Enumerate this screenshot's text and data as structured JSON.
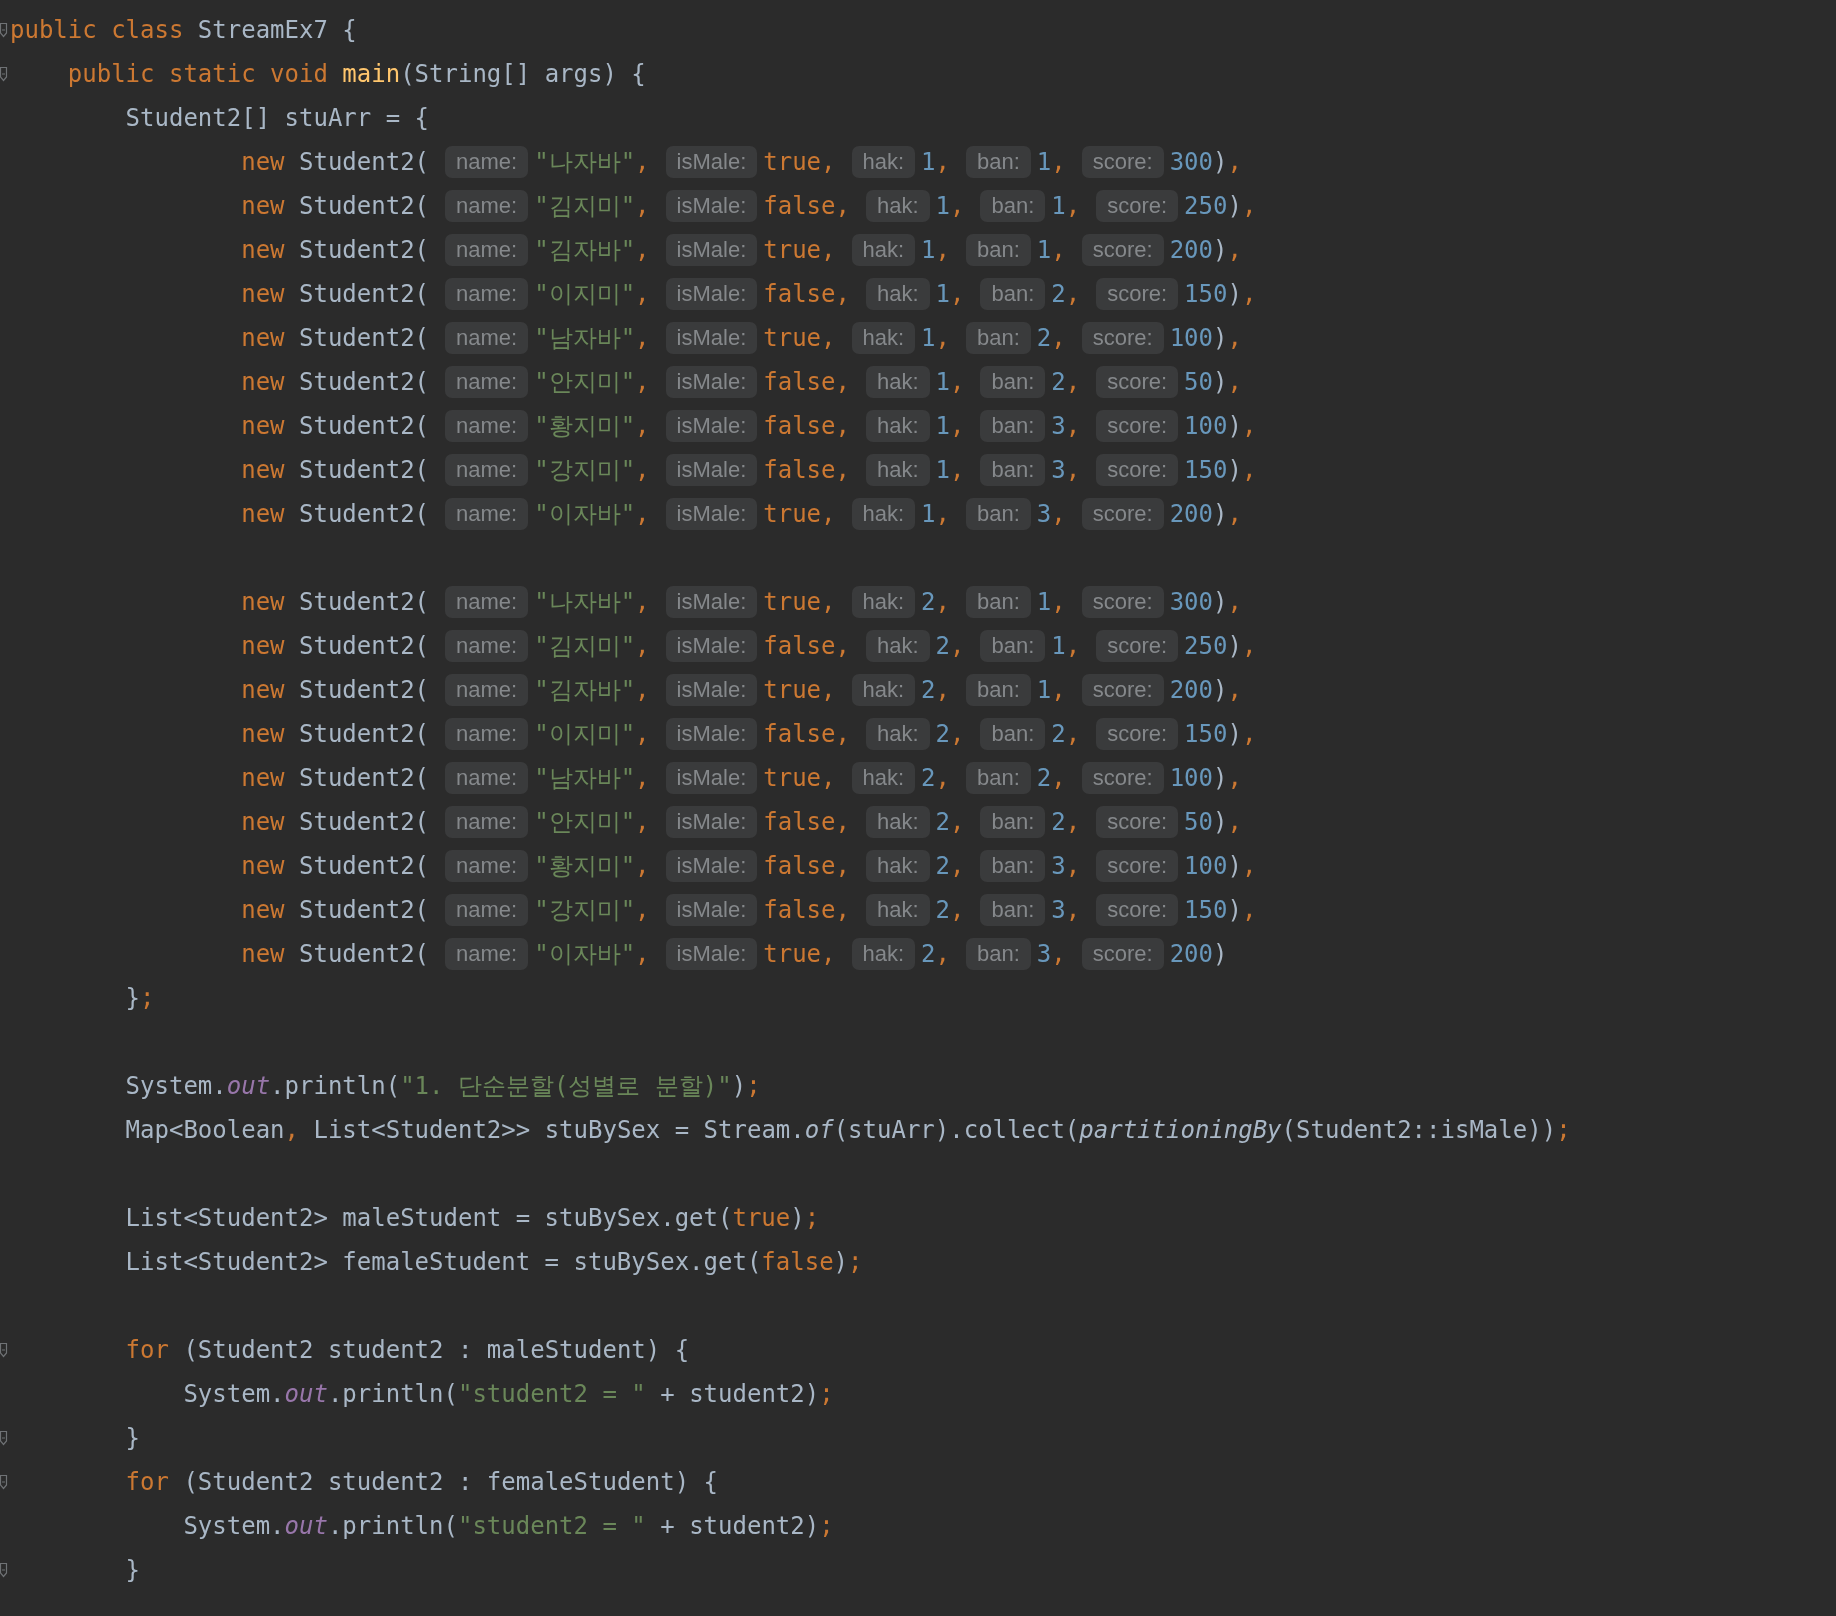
{
  "editor": {
    "lines": [
      {
        "kind": "code",
        "fold_mark": true,
        "tokens": [
          {
            "kind": "kw",
            "text": "public class"
          },
          {
            "kind": "plain",
            "text": " StreamEx7 {"
          }
        ],
        "children": [
          {
            "kind": "code",
            "fold_mark": true,
            "tokens": [
              {
                "kind": "kw",
                "text": "public static void "
              },
              {
                "kind": "fn",
                "text": "main"
              },
              {
                "kind": "plain",
                "text": "(String[] args) {"
              }
            ],
            "children": [
              {
                "kind": "code",
                "fold_mark": false,
                "tokens": [
                  {
                    "kind": "plain",
                    "text": "Student2[] stuArr = {"
                  }
                ],
                "children": [
                  {
                    "kind": "student",
                    "fold_mark": false,
                    "keyword": "new",
                    "call": " Student2(",
                    "args": [
                      {
                        "hint": "name:",
                        "value": "\"나자바\"",
                        "kind": "str",
                        "sep": ","
                      },
                      {
                        "hint": "isMale:",
                        "value": "true",
                        "kind": "kw",
                        "sep": ","
                      },
                      {
                        "hint": "hak:",
                        "value": "1",
                        "kind": "num",
                        "sep": ","
                      },
                      {
                        "hint": "ban:",
                        "value": "1",
                        "kind": "num",
                        "sep": ","
                      },
                      {
                        "hint": "score:",
                        "value": "300",
                        "kind": "num"
                      }
                    ],
                    "close": ")",
                    "end": ","
                  },
                  {
                    "kind": "student",
                    "fold_mark": false,
                    "keyword": "new",
                    "call": " Student2(",
                    "args": [
                      {
                        "hint": "name:",
                        "value": "\"김지미\"",
                        "kind": "str",
                        "sep": ","
                      },
                      {
                        "hint": "isMale:",
                        "value": "false",
                        "kind": "kw",
                        "sep": ","
                      },
                      {
                        "hint": "hak:",
                        "value": "1",
                        "kind": "num",
                        "sep": ","
                      },
                      {
                        "hint": "ban:",
                        "value": "1",
                        "kind": "num",
                        "sep": ","
                      },
                      {
                        "hint": "score:",
                        "value": "250",
                        "kind": "num"
                      }
                    ],
                    "close": ")",
                    "end": ","
                  },
                  {
                    "kind": "student",
                    "fold_mark": false,
                    "keyword": "new",
                    "call": " Student2(",
                    "args": [
                      {
                        "hint": "name:",
                        "value": "\"김자바\"",
                        "kind": "str",
                        "sep": ","
                      },
                      {
                        "hint": "isMale:",
                        "value": "true",
                        "kind": "kw",
                        "sep": ","
                      },
                      {
                        "hint": "hak:",
                        "value": "1",
                        "kind": "num",
                        "sep": ","
                      },
                      {
                        "hint": "ban:",
                        "value": "1",
                        "kind": "num",
                        "sep": ","
                      },
                      {
                        "hint": "score:",
                        "value": "200",
                        "kind": "num"
                      }
                    ],
                    "close": ")",
                    "end": ","
                  },
                  {
                    "kind": "student",
                    "fold_mark": false,
                    "keyword": "new",
                    "call": " Student2(",
                    "args": [
                      {
                        "hint": "name:",
                        "value": "\"이지미\"",
                        "kind": "str",
                        "sep": ","
                      },
                      {
                        "hint": "isMale:",
                        "value": "false",
                        "kind": "kw",
                        "sep": ","
                      },
                      {
                        "hint": "hak:",
                        "value": "1",
                        "kind": "num",
                        "sep": ","
                      },
                      {
                        "hint": "ban:",
                        "value": "2",
                        "kind": "num",
                        "sep": ","
                      },
                      {
                        "hint": "score:",
                        "value": "150",
                        "kind": "num"
                      }
                    ],
                    "close": ")",
                    "end": ","
                  },
                  {
                    "kind": "student",
                    "fold_mark": false,
                    "keyword": "new",
                    "call": " Student2(",
                    "args": [
                      {
                        "hint": "name:",
                        "value": "\"남자바\"",
                        "kind": "str",
                        "sep": ","
                      },
                      {
                        "hint": "isMale:",
                        "value": "true",
                        "kind": "kw",
                        "sep": ","
                      },
                      {
                        "hint": "hak:",
                        "value": "1",
                        "kind": "num",
                        "sep": ","
                      },
                      {
                        "hint": "ban:",
                        "value": "2",
                        "kind": "num",
                        "sep": ","
                      },
                      {
                        "hint": "score:",
                        "value": "100",
                        "kind": "num"
                      }
                    ],
                    "close": ")",
                    "end": ","
                  },
                  {
                    "kind": "student",
                    "fold_mark": false,
                    "keyword": "new",
                    "call": " Student2(",
                    "args": [
                      {
                        "hint": "name:",
                        "value": "\"안지미\"",
                        "kind": "str",
                        "sep": ","
                      },
                      {
                        "hint": "isMale:",
                        "value": "false",
                        "kind": "kw",
                        "sep": ","
                      },
                      {
                        "hint": "hak:",
                        "value": "1",
                        "kind": "num",
                        "sep": ","
                      },
                      {
                        "hint": "ban:",
                        "value": "2",
                        "kind": "num",
                        "sep": ","
                      },
                      {
                        "hint": "score:",
                        "value": "50",
                        "kind": "num"
                      }
                    ],
                    "close": ")",
                    "end": ","
                  },
                  {
                    "kind": "student",
                    "fold_mark": false,
                    "keyword": "new",
                    "call": " Student2(",
                    "args": [
                      {
                        "hint": "name:",
                        "value": "\"황지미\"",
                        "kind": "str",
                        "sep": ","
                      },
                      {
                        "hint": "isMale:",
                        "value": "false",
                        "kind": "kw",
                        "sep": ","
                      },
                      {
                        "hint": "hak:",
                        "value": "1",
                        "kind": "num",
                        "sep": ","
                      },
                      {
                        "hint": "ban:",
                        "value": "3",
                        "kind": "num",
                        "sep": ","
                      },
                      {
                        "hint": "score:",
                        "value": "100",
                        "kind": "num"
                      }
                    ],
                    "close": ")",
                    "end": ","
                  },
                  {
                    "kind": "student",
                    "fold_mark": false,
                    "keyword": "new",
                    "call": " Student2(",
                    "args": [
                      {
                        "hint": "name:",
                        "value": "\"강지미\"",
                        "kind": "str",
                        "sep": ","
                      },
                      {
                        "hint": "isMale:",
                        "value": "false",
                        "kind": "kw",
                        "sep": ","
                      },
                      {
                        "hint": "hak:",
                        "value": "1",
                        "kind": "num",
                        "sep": ","
                      },
                      {
                        "hint": "ban:",
                        "value": "3",
                        "kind": "num",
                        "sep": ","
                      },
                      {
                        "hint": "score:",
                        "value": "150",
                        "kind": "num"
                      }
                    ],
                    "close": ")",
                    "end": ","
                  },
                  {
                    "kind": "student",
                    "fold_mark": false,
                    "keyword": "new",
                    "call": " Student2(",
                    "args": [
                      {
                        "hint": "name:",
                        "value": "\"이자바\"",
                        "kind": "str",
                        "sep": ","
                      },
                      {
                        "hint": "isMale:",
                        "value": "true",
                        "kind": "kw",
                        "sep": ","
                      },
                      {
                        "hint": "hak:",
                        "value": "1",
                        "kind": "num",
                        "sep": ","
                      },
                      {
                        "hint": "ban:",
                        "value": "3",
                        "kind": "num",
                        "sep": ","
                      },
                      {
                        "hint": "score:",
                        "value": "200",
                        "kind": "num"
                      }
                    ],
                    "close": ")",
                    "end": ","
                  },
                  {
                    "kind": "blank",
                    "fold_mark": false
                  },
                  {
                    "kind": "student",
                    "fold_mark": false,
                    "keyword": "new",
                    "call": " Student2(",
                    "args": [
                      {
                        "hint": "name:",
                        "value": "\"나자바\"",
                        "kind": "str",
                        "sep": ","
                      },
                      {
                        "hint": "isMale:",
                        "value": "true",
                        "kind": "kw",
                        "sep": ","
                      },
                      {
                        "hint": "hak:",
                        "value": "2",
                        "kind": "num",
                        "sep": ","
                      },
                      {
                        "hint": "ban:",
                        "value": "1",
                        "kind": "num",
                        "sep": ","
                      },
                      {
                        "hint": "score:",
                        "value": "300",
                        "kind": "num"
                      }
                    ],
                    "close": ")",
                    "end": ","
                  },
                  {
                    "kind": "student",
                    "fold_mark": false,
                    "keyword": "new",
                    "call": " Student2(",
                    "args": [
                      {
                        "hint": "name:",
                        "value": "\"김지미\"",
                        "kind": "str",
                        "sep": ","
                      },
                      {
                        "hint": "isMale:",
                        "value": "false",
                        "kind": "kw",
                        "sep": ","
                      },
                      {
                        "hint": "hak:",
                        "value": "2",
                        "kind": "num",
                        "sep": ","
                      },
                      {
                        "hint": "ban:",
                        "value": "1",
                        "kind": "num",
                        "sep": ","
                      },
                      {
                        "hint": "score:",
                        "value": "250",
                        "kind": "num"
                      }
                    ],
                    "close": ")",
                    "end": ","
                  },
                  {
                    "kind": "student",
                    "fold_mark": false,
                    "keyword": "new",
                    "call": " Student2(",
                    "args": [
                      {
                        "hint": "name:",
                        "value": "\"김자바\"",
                        "kind": "str",
                        "sep": ","
                      },
                      {
                        "hint": "isMale:",
                        "value": "true",
                        "kind": "kw",
                        "sep": ","
                      },
                      {
                        "hint": "hak:",
                        "value": "2",
                        "kind": "num",
                        "sep": ","
                      },
                      {
                        "hint": "ban:",
                        "value": "1",
                        "kind": "num",
                        "sep": ","
                      },
                      {
                        "hint": "score:",
                        "value": "200",
                        "kind": "num"
                      }
                    ],
                    "close": ")",
                    "end": ","
                  },
                  {
                    "kind": "student",
                    "fold_mark": false,
                    "keyword": "new",
                    "call": " Student2(",
                    "args": [
                      {
                        "hint": "name:",
                        "value": "\"이지미\"",
                        "kind": "str",
                        "sep": ","
                      },
                      {
                        "hint": "isMale:",
                        "value": "false",
                        "kind": "kw",
                        "sep": ","
                      },
                      {
                        "hint": "hak:",
                        "value": "2",
                        "kind": "num",
                        "sep": ","
                      },
                      {
                        "hint": "ban:",
                        "value": "2",
                        "kind": "num",
                        "sep": ","
                      },
                      {
                        "hint": "score:",
                        "value": "150",
                        "kind": "num"
                      }
                    ],
                    "close": ")",
                    "end": ","
                  },
                  {
                    "kind": "student",
                    "fold_mark": false,
                    "keyword": "new",
                    "call": " Student2(",
                    "args": [
                      {
                        "hint": "name:",
                        "value": "\"남자바\"",
                        "kind": "str",
                        "sep": ","
                      },
                      {
                        "hint": "isMale:",
                        "value": "true",
                        "kind": "kw",
                        "sep": ","
                      },
                      {
                        "hint": "hak:",
                        "value": "2",
                        "kind": "num",
                        "sep": ","
                      },
                      {
                        "hint": "ban:",
                        "value": "2",
                        "kind": "num",
                        "sep": ","
                      },
                      {
                        "hint": "score:",
                        "value": "100",
                        "kind": "num"
                      }
                    ],
                    "close": ")",
                    "end": ","
                  },
                  {
                    "kind": "student",
                    "fold_mark": false,
                    "keyword": "new",
                    "call": " Student2(",
                    "args": [
                      {
                        "hint": "name:",
                        "value": "\"안지미\"",
                        "kind": "str",
                        "sep": ","
                      },
                      {
                        "hint": "isMale:",
                        "value": "false",
                        "kind": "kw",
                        "sep": ","
                      },
                      {
                        "hint": "hak:",
                        "value": "2",
                        "kind": "num",
                        "sep": ","
                      },
                      {
                        "hint": "ban:",
                        "value": "2",
                        "kind": "num",
                        "sep": ","
                      },
                      {
                        "hint": "score:",
                        "value": "50",
                        "kind": "num"
                      }
                    ],
                    "close": ")",
                    "end": ","
                  },
                  {
                    "kind": "student",
                    "fold_mark": false,
                    "keyword": "new",
                    "call": " Student2(",
                    "args": [
                      {
                        "hint": "name:",
                        "value": "\"황지미\"",
                        "kind": "str",
                        "sep": ","
                      },
                      {
                        "hint": "isMale:",
                        "value": "false",
                        "kind": "kw",
                        "sep": ","
                      },
                      {
                        "hint": "hak:",
                        "value": "2",
                        "kind": "num",
                        "sep": ","
                      },
                      {
                        "hint": "ban:",
                        "value": "3",
                        "kind": "num",
                        "sep": ","
                      },
                      {
                        "hint": "score:",
                        "value": "100",
                        "kind": "num"
                      }
                    ],
                    "close": ")",
                    "end": ","
                  },
                  {
                    "kind": "student",
                    "fold_mark": false,
                    "keyword": "new",
                    "call": " Student2(",
                    "args": [
                      {
                        "hint": "name:",
                        "value": "\"강지미\"",
                        "kind": "str",
                        "sep": ","
                      },
                      {
                        "hint": "isMale:",
                        "value": "false",
                        "kind": "kw",
                        "sep": ","
                      },
                      {
                        "hint": "hak:",
                        "value": "2",
                        "kind": "num",
                        "sep": ","
                      },
                      {
                        "hint": "ban:",
                        "value": "3",
                        "kind": "num",
                        "sep": ","
                      },
                      {
                        "hint": "score:",
                        "value": "150",
                        "kind": "num"
                      }
                    ],
                    "close": ")",
                    "end": ","
                  },
                  {
                    "kind": "student",
                    "fold_mark": false,
                    "keyword": "new",
                    "call": " Student2(",
                    "args": [
                      {
                        "hint": "name:",
                        "value": "\"이자바\"",
                        "kind": "str",
                        "sep": ","
                      },
                      {
                        "hint": "isMale:",
                        "value": "true",
                        "kind": "kw",
                        "sep": ","
                      },
                      {
                        "hint": "hak:",
                        "value": "2",
                        "kind": "num",
                        "sep": ","
                      },
                      {
                        "hint": "ban:",
                        "value": "3",
                        "kind": "num",
                        "sep": ","
                      },
                      {
                        "hint": "score:",
                        "value": "200",
                        "kind": "num"
                      }
                    ],
                    "close": ")"
                  }
                ]
              },
              {
                "kind": "code",
                "fold_mark": false,
                "tokens": [
                  {
                    "kind": "plain",
                    "text": "}"
                  },
                  {
                    "kind": "punct",
                    "text": ";"
                  }
                ]
              },
              {
                "kind": "blank",
                "fold_mark": false
              },
              {
                "kind": "code",
                "fold_mark": false,
                "tokens": [
                  {
                    "kind": "plain",
                    "text": "System."
                  },
                  {
                    "kind": "field",
                    "text": "out"
                  },
                  {
                    "kind": "plain",
                    "text": ".println("
                  },
                  {
                    "kind": "str",
                    "text": "\"1. 단순분할(성별로 분할)\""
                  },
                  {
                    "kind": "plain",
                    "text": ")"
                  },
                  {
                    "kind": "punct",
                    "text": ";"
                  }
                ]
              },
              {
                "kind": "code",
                "fold_mark": false,
                "tokens": [
                  {
                    "kind": "plain",
                    "text": "Map<Boolean"
                  },
                  {
                    "kind": "punct",
                    "text": ","
                  },
                  {
                    "kind": "plain",
                    "text": " List<Student2>> stuBySex = Stream."
                  },
                  {
                    "kind": "static",
                    "text": "of"
                  },
                  {
                    "kind": "plain",
                    "text": "(stuArr).collect("
                  },
                  {
                    "kind": "static",
                    "text": "partitioningBy"
                  },
                  {
                    "kind": "plain",
                    "text": "(Student2::isMale))"
                  },
                  {
                    "kind": "punct",
                    "text": ";"
                  }
                ]
              },
              {
                "kind": "blank",
                "fold_mark": false
              },
              {
                "kind": "code",
                "fold_mark": false,
                "tokens": [
                  {
                    "kind": "plain",
                    "text": "List<Student2> maleStudent = stuBySex.get("
                  },
                  {
                    "kind": "kw",
                    "text": "true"
                  },
                  {
                    "kind": "plain",
                    "text": ")"
                  },
                  {
                    "kind": "punct",
                    "text": ";"
                  }
                ]
              },
              {
                "kind": "code",
                "fold_mark": false,
                "tokens": [
                  {
                    "kind": "plain",
                    "text": "List<Student2> femaleStudent = stuBySex.get("
                  },
                  {
                    "kind": "kw",
                    "text": "false"
                  },
                  {
                    "kind": "plain",
                    "text": ")"
                  },
                  {
                    "kind": "punct",
                    "text": ";"
                  }
                ]
              },
              {
                "kind": "blank",
                "fold_mark": false
              },
              {
                "kind": "code",
                "fold_mark": true,
                "tokens": [
                  {
                    "kind": "kw",
                    "text": "for"
                  },
                  {
                    "kind": "plain",
                    "text": " (Student2 student2 : maleStudent) {"
                  }
                ],
                "children": [
                  {
                    "kind": "code",
                    "fold_mark": false,
                    "tokens": [
                      {
                        "kind": "plain",
                        "text": "System."
                      },
                      {
                        "kind": "field",
                        "text": "out"
                      },
                      {
                        "kind": "plain",
                        "text": ".println("
                      },
                      {
                        "kind": "str",
                        "text": "\"student2 = \""
                      },
                      {
                        "kind": "plain",
                        "text": " + student2)"
                      },
                      {
                        "kind": "punct",
                        "text": ";"
                      }
                    ]
                  }
                ]
              },
              {
                "kind": "code",
                "fold_mark": true,
                "tokens": [
                  {
                    "kind": "plain",
                    "text": "}"
                  }
                ]
              },
              {
                "kind": "code",
                "fold_mark": true,
                "tokens": [
                  {
                    "kind": "kw",
                    "text": "for"
                  },
                  {
                    "kind": "plain",
                    "text": " (Student2 student2 : femaleStudent) {"
                  }
                ],
                "children": [
                  {
                    "kind": "code",
                    "fold_mark": false,
                    "tokens": [
                      {
                        "kind": "plain",
                        "text": "System."
                      },
                      {
                        "kind": "field",
                        "text": "out"
                      },
                      {
                        "kind": "plain",
                        "text": ".println("
                      },
                      {
                        "kind": "str",
                        "text": "\"student2 = \""
                      },
                      {
                        "kind": "plain",
                        "text": " + student2)"
                      },
                      {
                        "kind": "punct",
                        "text": ";"
                      }
                    ]
                  }
                ]
              },
              {
                "kind": "code",
                "fold_mark": true,
                "tokens": [
                  {
                    "kind": "plain",
                    "text": "}"
                  }
                ]
              }
            ]
          }
        ]
      }
    ]
  }
}
